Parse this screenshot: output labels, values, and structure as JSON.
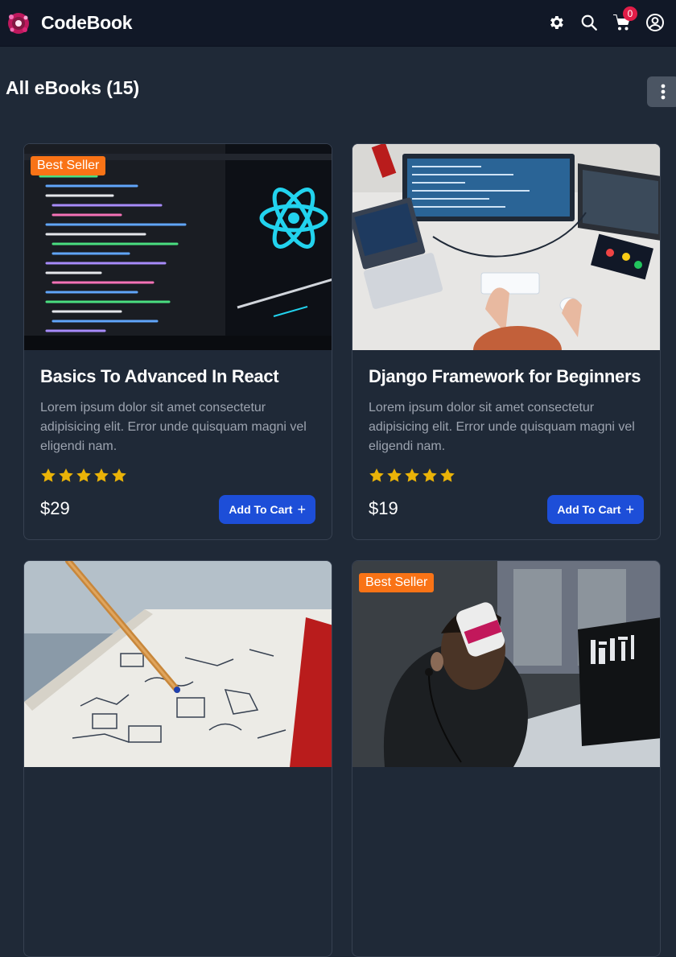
{
  "header": {
    "brand": "CodeBook",
    "cart_count": "0",
    "icons": [
      "settings-icon",
      "search-icon",
      "cart-icon",
      "user-icon"
    ]
  },
  "catalog": {
    "title": "All eBooks (15)",
    "menu_icon": "vertical-dots-icon"
  },
  "products": [
    {
      "name": "Basics To Advanced In React",
      "description": "Lorem ipsum dolor sit amet consectetur adipisicing elit. Error unde quisquam magni vel eligendi nam.",
      "price": "$29",
      "rating": 5,
      "best_seller": true,
      "badge": "Best Seller",
      "button": "Add To Cart"
    },
    {
      "name": "Django Framework for Beginners",
      "description": "Lorem ipsum dolor sit amet consectetur adipisicing elit. Error unde quisquam magni vel eligendi nam.",
      "price": "$19",
      "rating": 5,
      "best_seller": false,
      "button": "Add To Cart"
    },
    {
      "best_seller": false
    },
    {
      "best_seller": true,
      "badge": "Best Seller"
    }
  ],
  "colors": {
    "page_bg": "#1f2937",
    "header_bg": "#111827",
    "badge": "#f97316",
    "button": "#1d4ed8",
    "star": "#eab308",
    "cart_badge": "#e11d48"
  }
}
